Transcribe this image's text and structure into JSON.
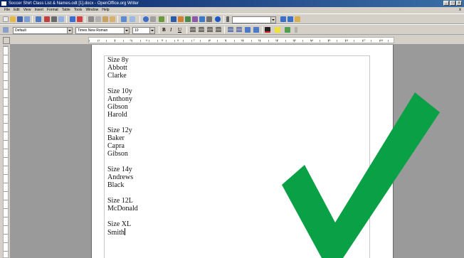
{
  "window": {
    "title": "Soccer Shirt Class List & Names.odt [1].docx - OpenOffice.org Writer",
    "controls": [
      "_",
      "□",
      "x"
    ]
  },
  "menubar": {
    "items": [
      "File",
      "Edit",
      "View",
      "Insert",
      "Format",
      "Table",
      "Tools",
      "Window",
      "Help"
    ],
    "close_doc": "x"
  },
  "formatting": {
    "paragraph_style": "Default",
    "font_name": "Times New Roman",
    "font_size": "10",
    "bold": "B",
    "italic": "I",
    "underline": "U"
  },
  "ruler": {
    "labels": [
      "1",
      "2",
      "3",
      "4",
      "5",
      "6",
      "7",
      "8",
      "9",
      "10",
      "11",
      "12",
      "13",
      "14",
      "15",
      "16",
      "17",
      "18"
    ]
  },
  "document": {
    "lines": [
      "Size 8y",
      "Abbott",
      "Clarke",
      "",
      "Size 10y",
      "Anthony",
      "Gibson",
      "Harold",
      "",
      "Size 12y",
      "Baker",
      "Capra",
      "Gibson",
      "",
      "Size 14y",
      "Andrews",
      "Black",
      "",
      "Size 12L",
      "McDonald",
      "",
      "Size XL",
      "Smith"
    ]
  },
  "overlay": {
    "icon": "checkmark-icon",
    "color": "#0aa046"
  }
}
